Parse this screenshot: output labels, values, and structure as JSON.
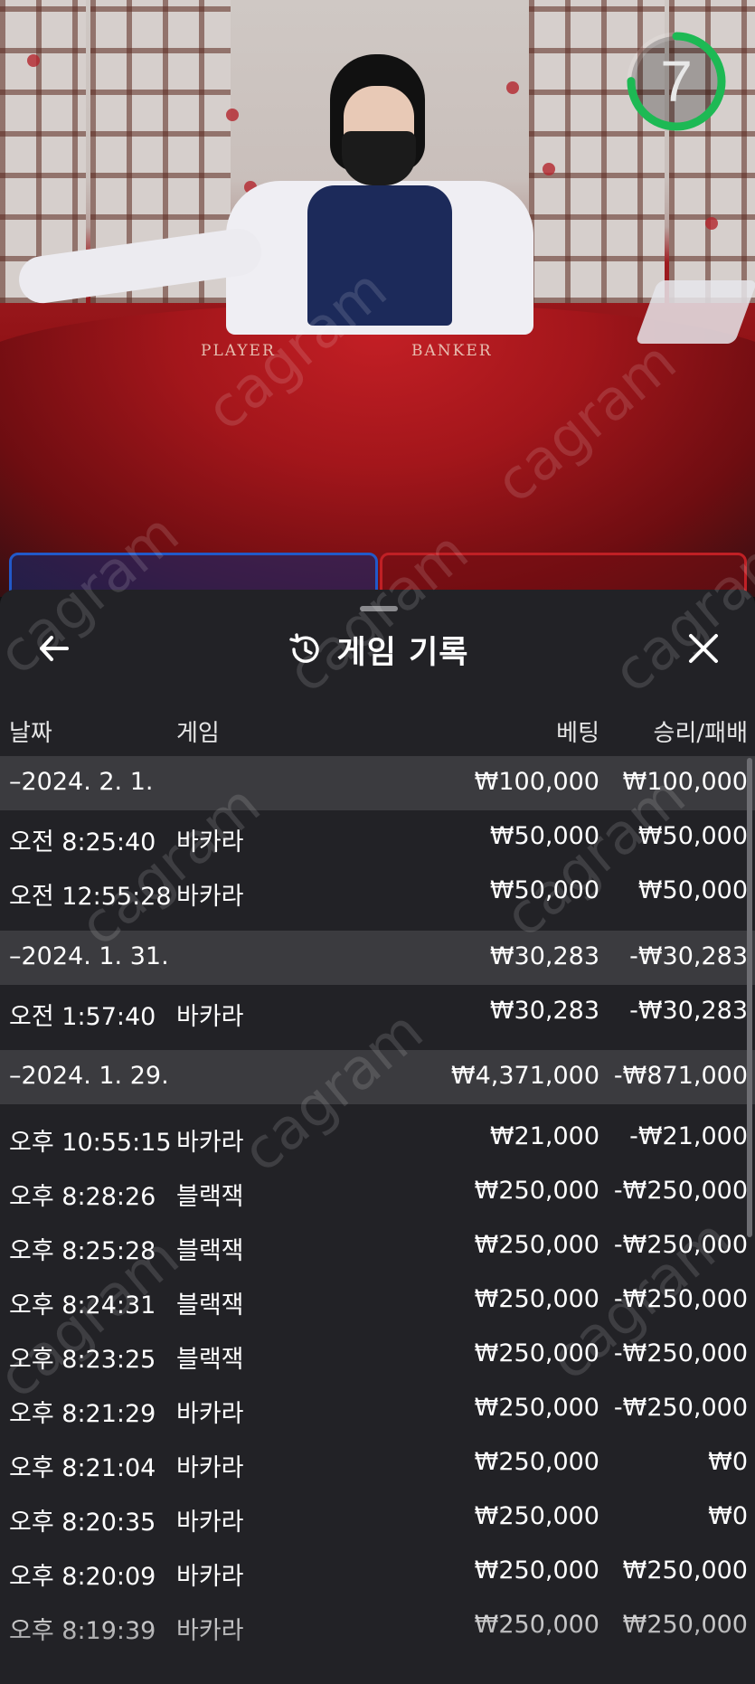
{
  "timer": {
    "value": "7",
    "progress": 0.75,
    "color": "#1db954"
  },
  "table_labels": {
    "player": "PLAYER",
    "banker": "BANKER"
  },
  "watermark": "cagram",
  "history": {
    "title": "게임 기록",
    "icons": {
      "back": "arrow-left-icon",
      "history": "history-clock-icon",
      "close": "close-x-icon"
    },
    "columns": {
      "date": "날짜",
      "game": "게임",
      "bet": "베팅",
      "result": "승리/패배"
    },
    "rows": [
      {
        "type": "group",
        "date": "–2024. 2. 1.",
        "bet": "₩100,000",
        "result": "₩100,000"
      },
      {
        "type": "item",
        "date": "오전 8:25:40",
        "game": "바카라",
        "bet": "₩50,000",
        "result": "₩50,000"
      },
      {
        "type": "item",
        "date": "오전 12:55:28",
        "game": "바카라",
        "bet": "₩50,000",
        "result": "₩50,000"
      },
      {
        "type": "group",
        "date": "–2024. 1. 31.",
        "bet": "₩30,283",
        "result": "-₩30,283"
      },
      {
        "type": "item",
        "date": "오전 1:57:40",
        "game": "바카라",
        "bet": "₩30,283",
        "result": "-₩30,283"
      },
      {
        "type": "group",
        "date": "–2024. 1. 29.",
        "bet": "₩4,371,000",
        "result": "-₩871,000"
      },
      {
        "type": "item",
        "date": "오후 10:55:15",
        "game": "바카라",
        "bet": "₩21,000",
        "result": "-₩21,000"
      },
      {
        "type": "item",
        "date": "오후 8:28:26",
        "game": "블랙잭",
        "bet": "₩250,000",
        "result": "-₩250,000"
      },
      {
        "type": "item",
        "date": "오후 8:25:28",
        "game": "블랙잭",
        "bet": "₩250,000",
        "result": "-₩250,000"
      },
      {
        "type": "item",
        "date": "오후 8:24:31",
        "game": "블랙잭",
        "bet": "₩250,000",
        "result": "-₩250,000"
      },
      {
        "type": "item",
        "date": "오후 8:23:25",
        "game": "블랙잭",
        "bet": "₩250,000",
        "result": "-₩250,000"
      },
      {
        "type": "item",
        "date": "오후 8:21:29",
        "game": "바카라",
        "bet": "₩250,000",
        "result": "-₩250,000"
      },
      {
        "type": "item",
        "date": "오후 8:21:04",
        "game": "바카라",
        "bet": "₩250,000",
        "result": "₩0"
      },
      {
        "type": "item",
        "date": "오후 8:20:35",
        "game": "바카라",
        "bet": "₩250,000",
        "result": "₩0"
      },
      {
        "type": "item",
        "date": "오후 8:20:09",
        "game": "바카라",
        "bet": "₩250,000",
        "result": "₩250,000"
      },
      {
        "type": "item",
        "date": "오후 8:19:39",
        "game": "바카라",
        "bet": "₩250,000",
        "result": "₩250,000"
      }
    ]
  }
}
